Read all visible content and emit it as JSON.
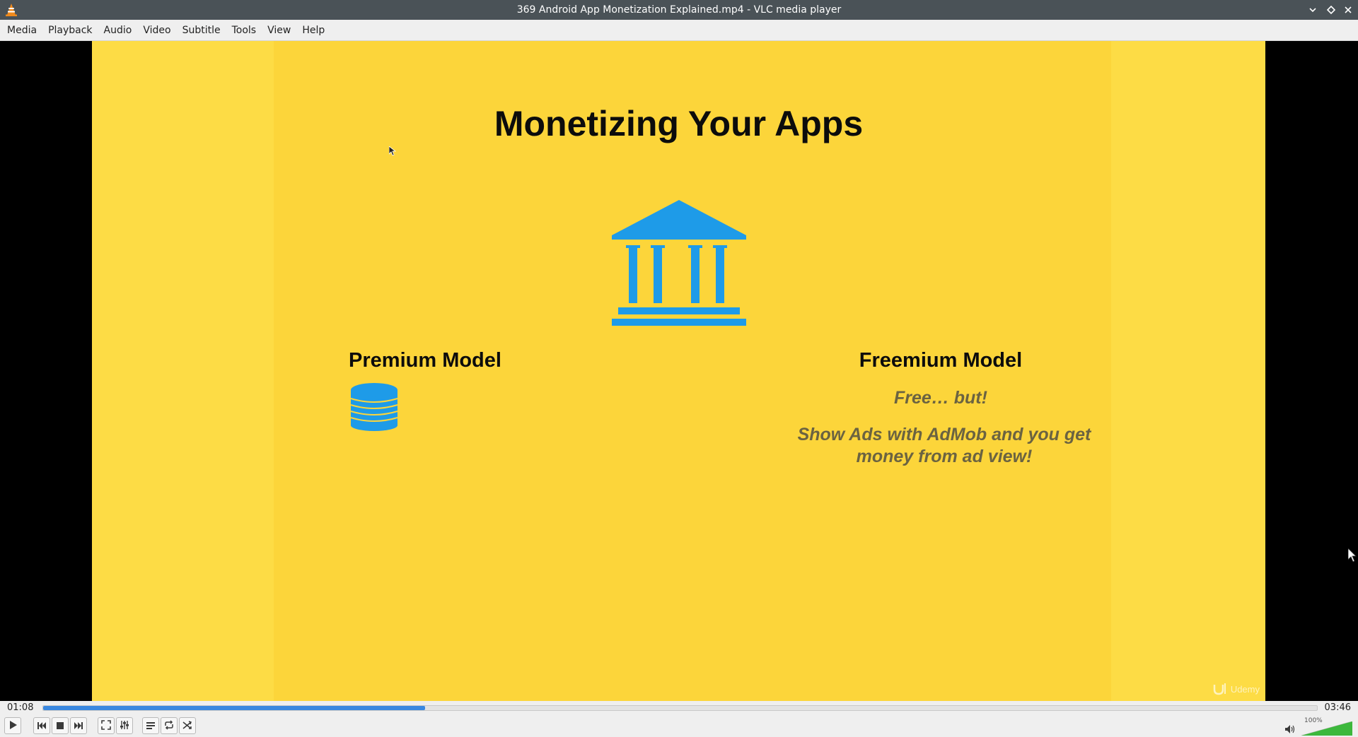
{
  "window": {
    "title": "369 Android App Monetization Explained.mp4 - VLC media player",
    "icons": [
      "vlc-cone-icon",
      "minimize-icon",
      "maximize-icon",
      "close-icon"
    ]
  },
  "menu": {
    "items": [
      "Media",
      "Playback",
      "Audio",
      "Video",
      "Subtitle",
      "Tools",
      "View",
      "Help"
    ]
  },
  "slide": {
    "title": "Monetizing Your Apps",
    "premium": {
      "title": "Premium Model"
    },
    "freemium": {
      "title": "Freemium Model",
      "subtitle": "Free… but!",
      "description": "Show Ads with AdMob and you get money from ad view!"
    },
    "watermark": "Udemy",
    "colors": {
      "background": "#fddc45",
      "panel": "#fcd53a",
      "icon_blue": "#1e9be8",
      "title_text": "#0c0c0c",
      "sub_text": "#6b6341"
    }
  },
  "playback": {
    "elapsed": "01:08",
    "total": "03:46",
    "progress": 0.3,
    "volume_label": "100%",
    "volume_level": 1.0,
    "colors": {
      "progress_fill": "#3a88e0",
      "volume_fill": "#3cb83c"
    }
  },
  "controls": {
    "icons": [
      "play-icon",
      "previous-icon",
      "stop-icon",
      "next-icon",
      "fullscreen-icon",
      "extended-settings-icon",
      "playlist-icon",
      "loop-icon",
      "shuffle-icon",
      "volume-icon"
    ]
  }
}
